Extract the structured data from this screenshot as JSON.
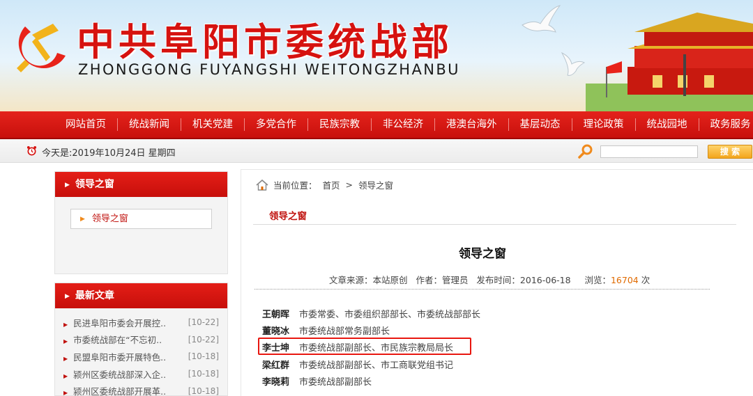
{
  "header": {
    "site_title": "中共阜阳市委统战部",
    "site_pinyin": "ZHONGGONG FUYANGSHI WEITONGZHANBU",
    "accent_color": "#d6120f"
  },
  "nav": {
    "items": [
      "网站首页",
      "统战新闻",
      "机关党建",
      "多党合作",
      "民族宗教",
      "非公经济",
      "港澳台海外",
      "基层动态",
      "理论政策",
      "统战园地",
      "政务服务"
    ]
  },
  "datebar": {
    "date_text": "今天是:2019年10月24日 星期四",
    "search_button": "搜 索"
  },
  "sidebar": {
    "section1": {
      "title": "领导之窗",
      "items": [
        "领导之窗"
      ]
    },
    "section2": {
      "title": "最新文章",
      "items": [
        {
          "title": "民进阜阳市委会开展控..",
          "date": "[10-22]"
        },
        {
          "title": "市委统战部在“不忘初..",
          "date": "[10-22]"
        },
        {
          "title": "民盟阜阳市委开展特色..",
          "date": "[10-18]"
        },
        {
          "title": "颍州区委统战部深入企..",
          "date": "[10-18]"
        },
        {
          "title": "颍州区委统战部开展革..",
          "date": "[10-18]"
        }
      ]
    }
  },
  "main": {
    "breadcrumb": {
      "label": "当前位置：",
      "home": "首页",
      "sep": ">",
      "current": "领导之窗"
    },
    "section_tab": "领导之窗",
    "article": {
      "title": "领导之窗",
      "meta": {
        "source_label": "文章来源：",
        "source": "本站原创",
        "author_label": "作者：",
        "author": "管理员",
        "time_label": "发布时间：",
        "time": "2016-06-18",
        "views_label": "浏览：",
        "views": "16704",
        "views_unit": "次"
      },
      "leaders": [
        {
          "name": "王朝晖",
          "position": "市委常委、市委组织部部长、市委统战部部长"
        },
        {
          "name": "董晓冰",
          "position": "市委统战部常务副部长"
        },
        {
          "name": "李士坤",
          "position": "市委统战部副部长、市民族宗教局局长"
        },
        {
          "name": "梁红群",
          "position": "市委统战部副部长、市工商联党组书记"
        },
        {
          "name": "李晓莉",
          "position": "市委统战部副部长"
        }
      ]
    }
  }
}
